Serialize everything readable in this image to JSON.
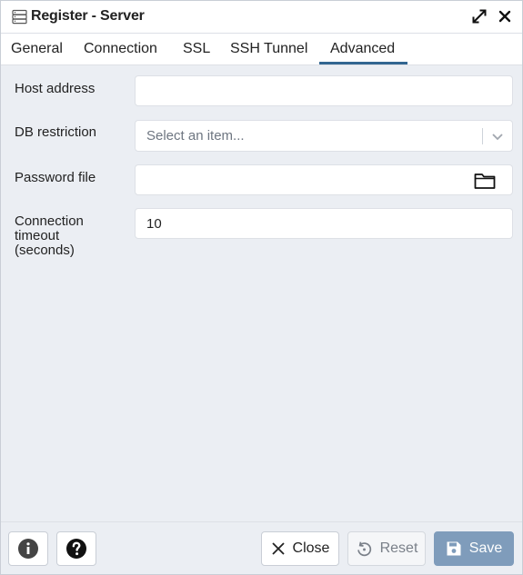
{
  "window": {
    "title": "Register - Server"
  },
  "tabs": [
    "General",
    "Connection",
    "SSL",
    "SSH Tunnel",
    "Advanced"
  ],
  "active_tab": "Advanced",
  "fields": {
    "host_address": {
      "label": "Host address",
      "value": ""
    },
    "db_restriction": {
      "label": "DB restriction",
      "placeholder": "Select an item..."
    },
    "password_file": {
      "label": "Password file",
      "value": ""
    },
    "connection_timeout": {
      "label_lines": [
        "Connection",
        "timeout",
        "(seconds)"
      ],
      "value": "10"
    }
  },
  "footer": {
    "close_label": "Close",
    "reset_label": "Reset",
    "save_label": "Save"
  },
  "colors": {
    "accent": "#326690",
    "save_bg": "#7f9cbb",
    "panel_bg": "#ebeef3"
  }
}
